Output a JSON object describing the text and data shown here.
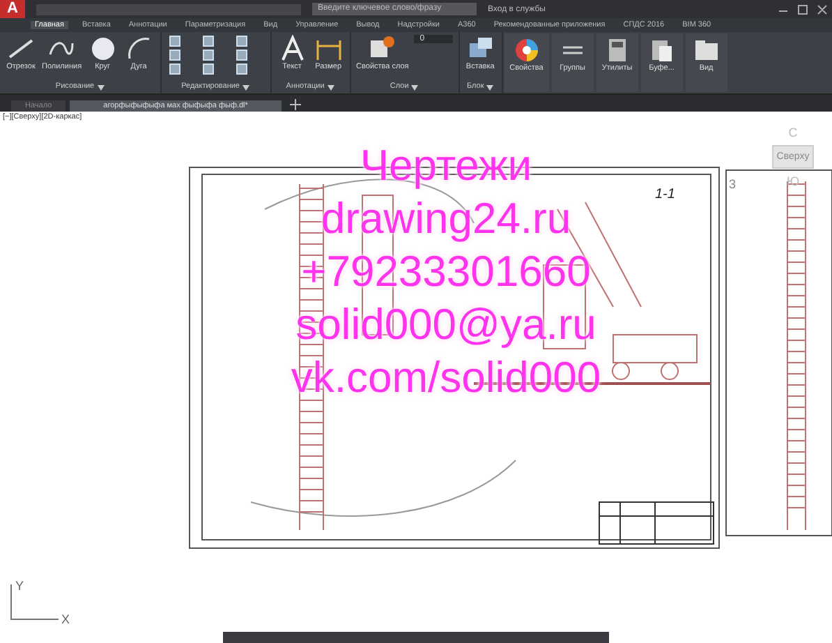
{
  "title_bar": {
    "app_logo": "A",
    "search_placeholder": "Введите ключевое слово/фразу",
    "sign_in": "Вход в службы"
  },
  "ribbon_tabs": [
    {
      "label": "Главная",
      "selected": true
    },
    {
      "label": "Вставка",
      "selected": false
    },
    {
      "label": "Аннотации",
      "selected": false
    },
    {
      "label": "Параметризация",
      "selected": false
    },
    {
      "label": "Вид",
      "selected": false
    },
    {
      "label": "Управление",
      "selected": false
    },
    {
      "label": "Вывод",
      "selected": false
    },
    {
      "label": "Надстройки",
      "selected": false
    },
    {
      "label": "A360",
      "selected": false
    },
    {
      "label": "Рекомендованные приложения",
      "selected": false
    },
    {
      "label": "СПДС 2016",
      "selected": false
    },
    {
      "label": "BIM 360",
      "selected": false
    }
  ],
  "ribbon_panels": [
    {
      "title": "Рисование",
      "tools": [
        {
          "label": "Отрезок",
          "kind": "line"
        },
        {
          "label": "Полилиния",
          "kind": "polyline"
        },
        {
          "label": "Круг",
          "kind": "circle"
        },
        {
          "label": "Дуга",
          "kind": "arc"
        }
      ]
    },
    {
      "title": "Редактирование",
      "tools": [
        {
          "kind": "modify"
        }
      ]
    },
    {
      "title": "Аннотации",
      "tools": [
        {
          "label": "Текст",
          "kind": "text"
        },
        {
          "label": "Размер",
          "kind": "dimension"
        }
      ]
    },
    {
      "title": "Слои",
      "layer": "0",
      "tools": [
        {
          "label": "Свойства слоя",
          "kind": "layers"
        }
      ]
    },
    {
      "title": "Блок",
      "tools": [
        {
          "label": "Вставка",
          "kind": "insert"
        }
      ]
    },
    {
      "tools": [
        {
          "label": "Свойства",
          "kind": "properties"
        }
      ]
    },
    {
      "tools": [
        {
          "label": "Группы",
          "kind": "groups"
        }
      ]
    },
    {
      "tools": [
        {
          "label": "Утилиты",
          "kind": "utilities"
        }
      ]
    },
    {
      "tools": [
        {
          "label": "Буфе...",
          "kind": "clipboard"
        }
      ]
    },
    {
      "tools": [
        {
          "label": "Вид",
          "kind": "view"
        }
      ]
    }
  ],
  "document_tabs": [
    {
      "label": "Начало",
      "selected": false
    },
    {
      "label": "агорфыфыфыфа мах фыфыфа фыф.dl*",
      "selected": true
    }
  ],
  "viewport_label": "[−][Сверху][2D-каркас]",
  "view_cube": {
    "north": "С",
    "face": "Сверху",
    "south": "Ю"
  },
  "sheets": [
    {
      "title": "1-1"
    },
    {
      "title": "3"
    }
  ],
  "overlay_lines": [
    "Чертежи",
    "drawing24.ru",
    "+79233301660",
    "solid000@ya.ru",
    "vk.com/solid000"
  ],
  "ucs": {
    "x": "X",
    "y": "Y"
  }
}
